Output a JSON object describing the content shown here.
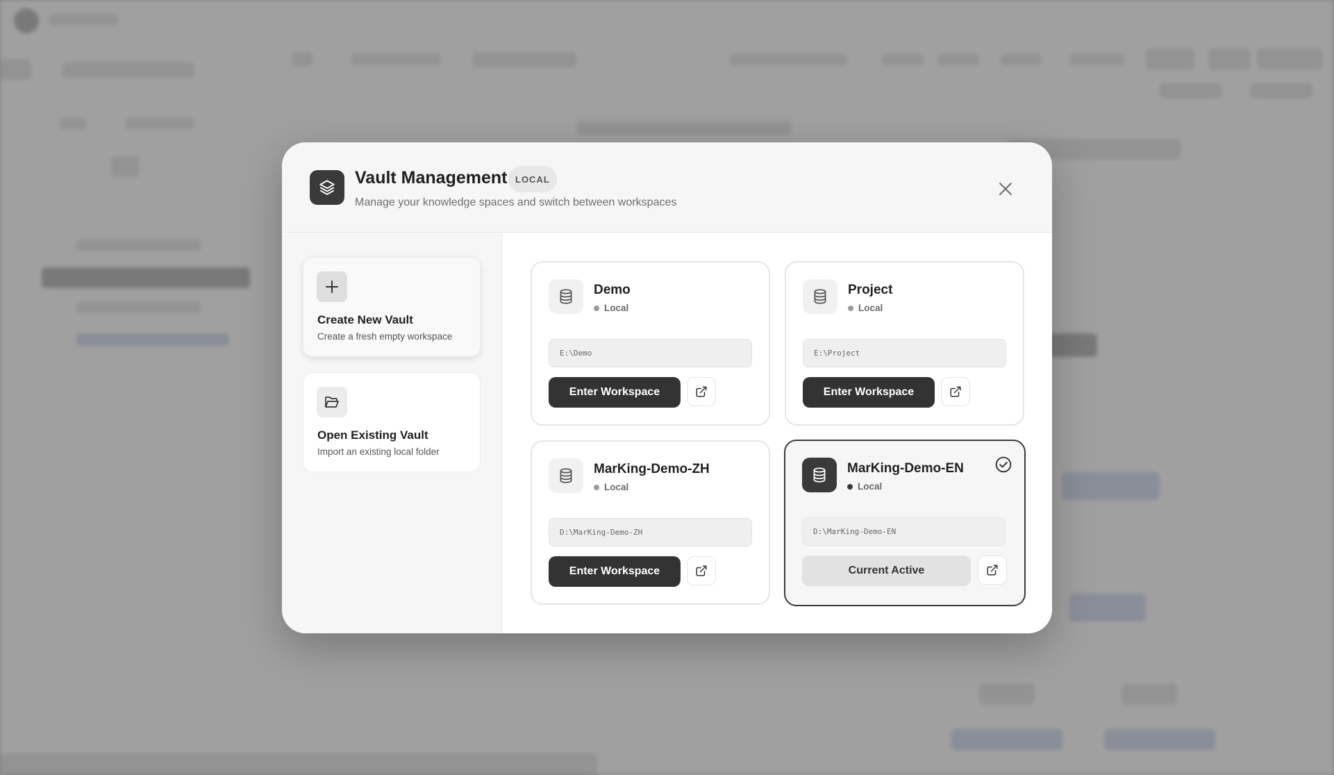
{
  "modal": {
    "title": "Vault Management",
    "badge": "LOCAL",
    "subtitle": "Manage your knowledge spaces and switch between workspaces",
    "icons": {
      "app": "layers-icon",
      "close": "close-icon"
    }
  },
  "sidebar": {
    "create": {
      "title": "Create New Vault",
      "desc": "Create a fresh empty workspace",
      "icon": "plus-icon"
    },
    "open": {
      "title": "Open Existing Vault",
      "desc": "Import an existing local folder",
      "icon": "folder-open-icon"
    }
  },
  "vaults": [
    {
      "name": "Demo",
      "status": "Local",
      "path": "E:\\Demo",
      "button": "Enter Workspace",
      "active": false
    },
    {
      "name": "Project",
      "status": "Local",
      "path": "E:\\Project",
      "button": "Enter Workspace",
      "active": false
    },
    {
      "name": "MarKing-Demo-ZH",
      "status": "Local",
      "path": "D:\\MarKing-Demo-ZH",
      "button": "Enter Workspace",
      "active": false
    },
    {
      "name": "MarKing-Demo-EN",
      "status": "Local",
      "path": "D:\\MarKing-Demo-EN",
      "button": "Current Active",
      "active": true
    }
  ],
  "colors": {
    "accent": "#333333",
    "active_border": "#3a3a3a",
    "overlay": "#6e6e6e"
  }
}
